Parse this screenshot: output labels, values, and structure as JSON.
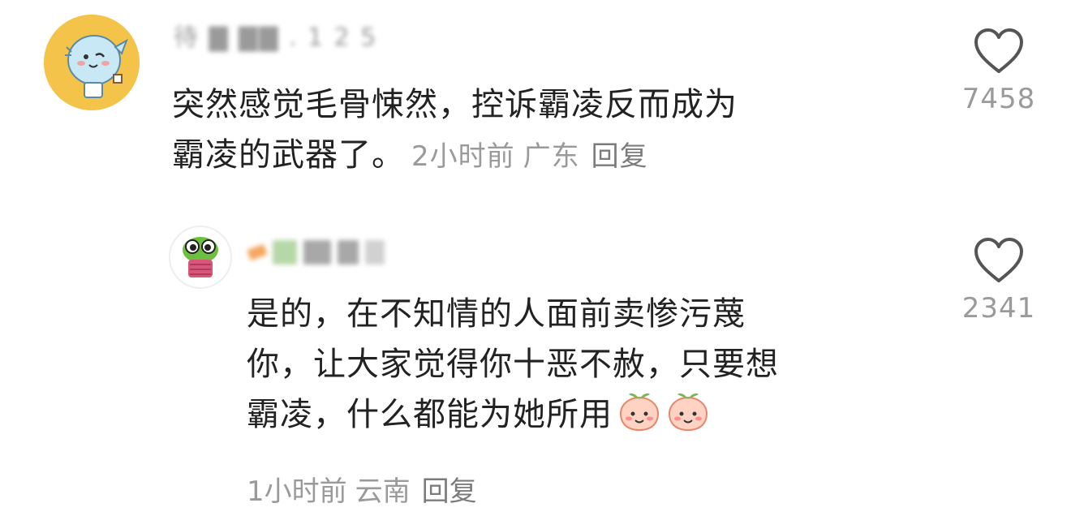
{
  "comments": [
    {
      "username": "待 ▇ ▇▇ . 1 2 5",
      "text_line1": "突然感觉毛骨悚然，控诉霸凌反而成为",
      "text_line2": "霸凌的武器了。",
      "time": "2小时前",
      "location": "广东",
      "reply_label": "回复",
      "likes": "7458",
      "avatar_icon": "cartoon-waving-character-icon",
      "avatar_color": "#f4c44a"
    },
    {
      "username": "",
      "text_line1": "是的，在不知情的人面前卖惨污蔑",
      "text_line2": "你，让大家觉得你十恶不赦，只要想",
      "text_line3": "霸凌，什么都能为她所用",
      "emojis": [
        "peach-smile-icon",
        "peach-smile-icon"
      ],
      "time": "1小时前",
      "location": "云南",
      "reply_label": "回复",
      "likes": "2341",
      "avatar_icon": "green-frog-character-icon"
    }
  ],
  "colors": {
    "meta_gray": "#9a9a9a",
    "text": "#222222",
    "heart_stroke": "#555555"
  }
}
